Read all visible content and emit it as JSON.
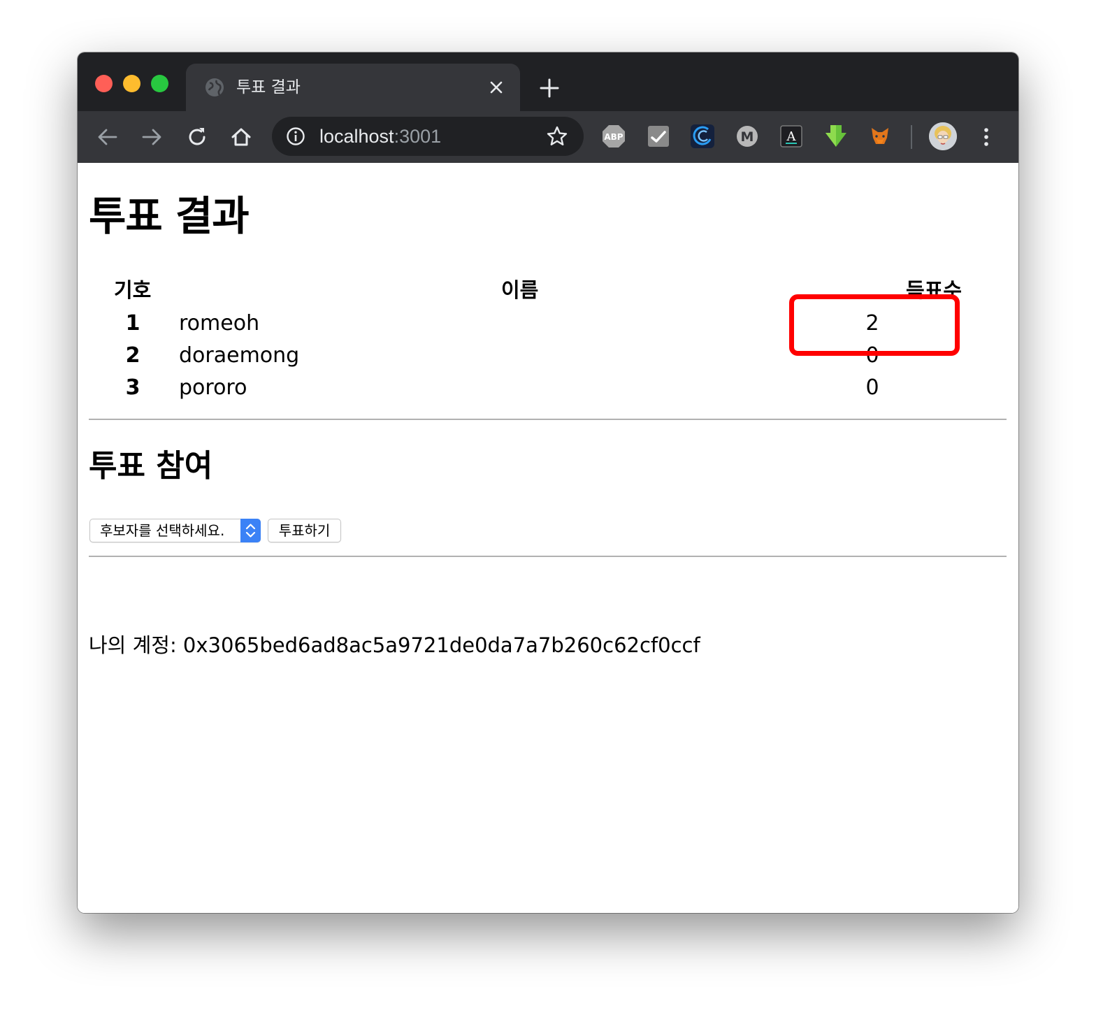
{
  "browser": {
    "tab_title": "투표 결과",
    "url_host": "localhost",
    "url_port": ":3001",
    "extensions": [
      {
        "name": "adblock-plus-icon",
        "label": "ABP"
      },
      {
        "name": "chart-extension-icon"
      },
      {
        "name": "wave-extension-icon"
      },
      {
        "name": "m-extension-icon",
        "label": "M"
      },
      {
        "name": "font-extension-icon",
        "label": "A"
      },
      {
        "name": "download-arrow-icon"
      },
      {
        "name": "metamask-fox-icon"
      }
    ],
    "colors": {
      "tabbar": "#202124",
      "toolbar": "#35363a",
      "active_tab": "#35363a"
    }
  },
  "results": {
    "title": "투표 결과",
    "headers": {
      "number": "기호",
      "name": "이름",
      "votes": "득표수"
    },
    "rows": [
      {
        "number": "1",
        "name": "romeoh",
        "votes": "2"
      },
      {
        "number": "2",
        "name": "doraemong",
        "votes": "0"
      },
      {
        "number": "3",
        "name": "pororo",
        "votes": "0"
      }
    ],
    "highlight_color": "#ff0000"
  },
  "vote": {
    "title": "투표 참여",
    "select_value": "후보자를 선택하세요.",
    "button_label": "투표하기",
    "select_accent": "#3b82f6"
  },
  "account": {
    "label": "나의 계정: 0x3065bed6ad8ac5a9721de0da7a7b260c62cf0ccf"
  }
}
